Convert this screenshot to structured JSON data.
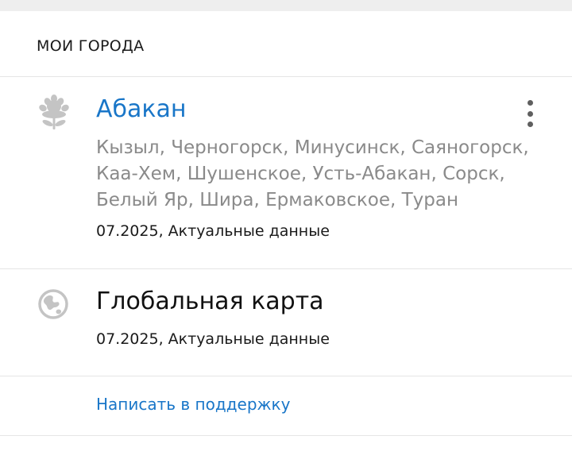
{
  "section": {
    "title": "МОИ ГОРОДА"
  },
  "city": {
    "name": "Абакан",
    "nearby": "Кызыл, Черногорск, Минусинск, Саяногорск, Каа-Хем, Шушенское, Усть-Абакан, Сорск, Белый Яр, Шира, Ермаковское, Туран",
    "status": "07.2025, Актуальные данные"
  },
  "global_map": {
    "title": "Глобальная карта",
    "status": "07.2025, Актуальные данные"
  },
  "support": {
    "link_label": "Написать в поддержку"
  },
  "colors": {
    "accent": "#1976c8",
    "icon_gray": "#c4c4c4",
    "secondary_text": "#8a8a8a"
  }
}
